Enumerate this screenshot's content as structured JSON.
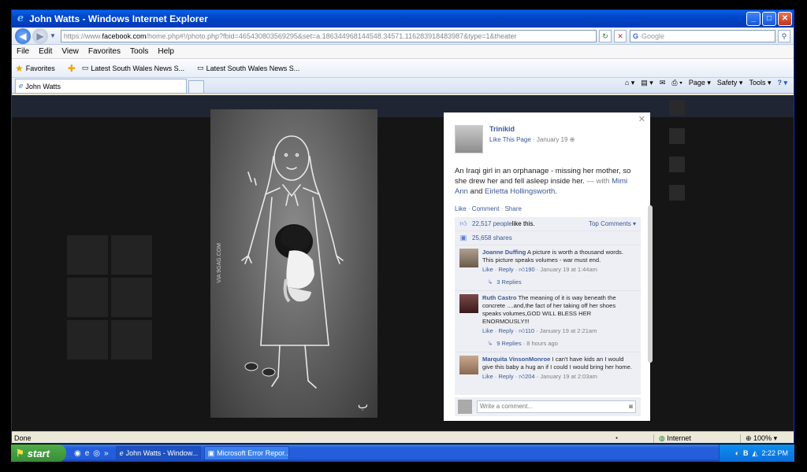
{
  "window": {
    "title": "John Watts - Windows Internet Explorer"
  },
  "address": {
    "prefix": "https://www.",
    "domain": "facebook.com",
    "rest": "/home.php#!/photo.php?fbid=465430803569295&set=a.186344968144548.34571.116283918483987&type=1&theater"
  },
  "search": {
    "placeholder": "Google"
  },
  "menu": [
    "File",
    "Edit",
    "View",
    "Favorites",
    "Tools",
    "Help"
  ],
  "favorites": {
    "label": "Favorites",
    "items": [
      "Latest South Wales News  S...",
      "Latest South Wales News  S..."
    ]
  },
  "tab": {
    "label": "John Watts"
  },
  "commandbar": {
    "page": "Page ▾",
    "safety": "Safety ▾",
    "tools": "Tools ▾"
  },
  "photo": {
    "watermark": "VIA 9GAG.COM"
  },
  "post": {
    "page_name": "Trinikid",
    "like_page": "Like This Page",
    "date": "January 19",
    "caption": "An Iraqi girl in an orphanage - missing her mother, so she drew her and fell asleep inside her.",
    "with_prefix": " — with ",
    "tag1": "Mimi Ann",
    "and": " and ",
    "tag2": "Eirletta Hollingsworth",
    "period": ".",
    "like": "Like",
    "comment": "Comment",
    "share": "Share",
    "likes_count": "22,517 people",
    "likes_suffix": " like this.",
    "top_comments": "Top Comments ▾",
    "shares": "25,658 shares"
  },
  "comments": [
    {
      "name": "Joanne Duffing",
      "text": "A picture is worth a thousand words. This picture speaks volumes - war must end.",
      "likes": "190",
      "time": "January 19 at 1:44am",
      "replies": "3 Replies",
      "replies_time": ""
    },
    {
      "name": "Ruth Castro",
      "text": "The meaning of it is way beneath the concrete ....and,the fact of her taking off her shoes speaks volumes,GOD WILL BLESS HER ENORMOUSLY!!!",
      "likes": "110",
      "time": "January 19 at 2:21am",
      "replies": "9 Replies",
      "replies_time": "8 hours ago"
    },
    {
      "name": "Marquita VinsonMonroe",
      "text": "I can't have kids an I would give this baby a hug an if I could I would bring her home.",
      "likes": "204",
      "time": "January 19 at 2:03am",
      "replies": "",
      "replies_time": ""
    }
  ],
  "comment_meta": {
    "like": "Like",
    "reply": "Reply"
  },
  "write_comment": {
    "placeholder": "Write a comment..."
  },
  "status": {
    "text": "Done",
    "zone": "Internet",
    "zoom": "100%"
  },
  "taskbar": {
    "start": "start",
    "tasks": [
      "John Watts - Window...",
      "Microsoft Error Repor..."
    ],
    "clock": "2:22 PM"
  },
  "colors": {
    "facebook_blue": "#3b5998",
    "xp_blue": "#245edb",
    "start_green": "#3a8d36"
  }
}
